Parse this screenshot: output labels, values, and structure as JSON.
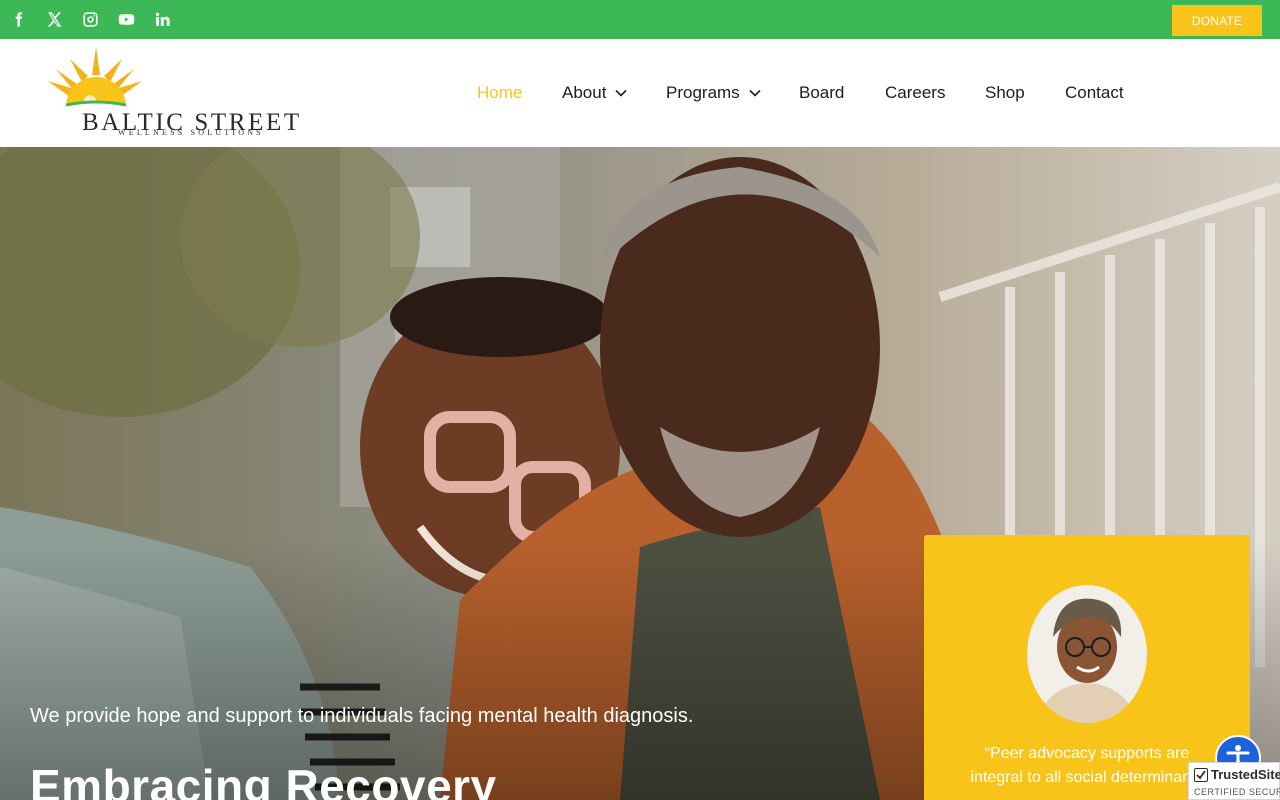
{
  "topbar": {
    "social": [
      {
        "icon": "facebook-icon"
      },
      {
        "icon": "x-twitter-icon"
      },
      {
        "icon": "instagram-icon"
      },
      {
        "icon": "youtube-icon"
      },
      {
        "icon": "linkedin-icon"
      }
    ],
    "donate_label": "DONATE"
  },
  "logo": {
    "title": "BALTIC STREET",
    "subtitle": "WELLNESS SOLUTIONS"
  },
  "nav": {
    "items": [
      {
        "label": "Home",
        "active": true
      },
      {
        "label": "About",
        "dropdown": true
      },
      {
        "label": "Programs",
        "dropdown": true
      },
      {
        "label": "Board"
      },
      {
        "label": "Careers"
      },
      {
        "label": "Shop"
      },
      {
        "label": "Contact"
      }
    ]
  },
  "hero": {
    "tagline": "We provide hope and support to individuals facing mental health diagnosis.",
    "title": "Embracing Recovery"
  },
  "quote": {
    "text": "“Peer advocacy supports are integral to all social determinants"
  },
  "trustbadge": {
    "name": "TrustedSite",
    "subtitle": "CERTIFIED SECURE"
  },
  "accessibility": {
    "icon": "accessibility-icon"
  },
  "colors": {
    "topbar_green": "#3db856",
    "accent_yellow": "#f9c41a",
    "a11y_blue": "#1e62d9"
  }
}
